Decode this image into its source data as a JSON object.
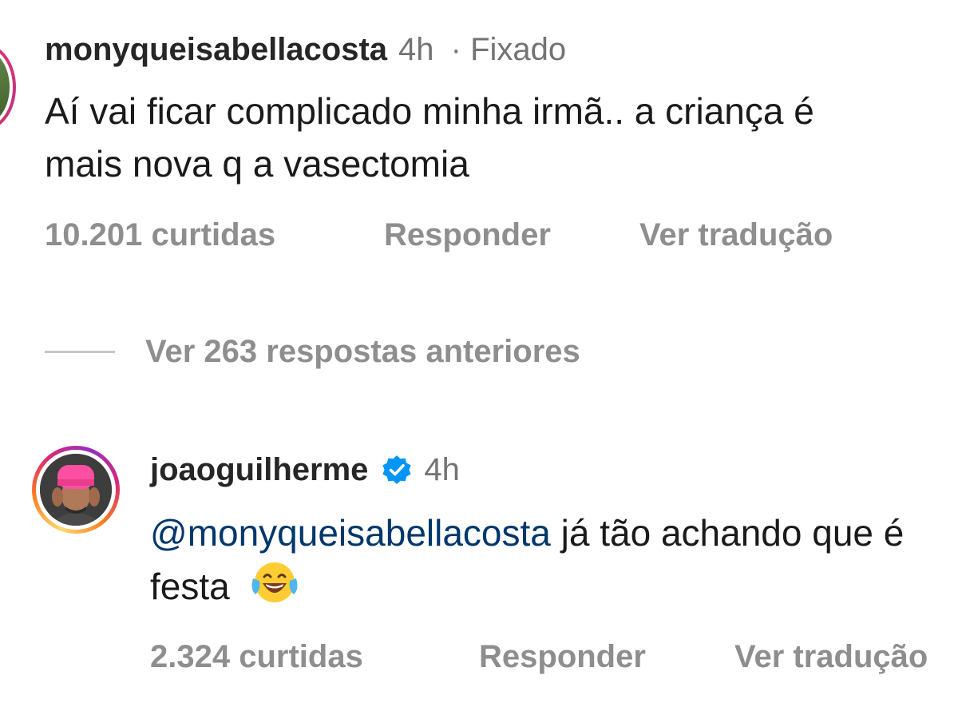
{
  "comment": {
    "username": "monyqueisabellacosta",
    "time": "4h",
    "pinned_label": "· Fixado",
    "text": "Aí vai ficar complicado minha irmã.. a criança é mais nova q a vasectomia",
    "likes_label": "10.201 curtidas",
    "reply_label": "Responder",
    "translate_label": "Ver tradução"
  },
  "view_more": {
    "label": "Ver 263 respostas anteriores"
  },
  "reply": {
    "username": "joaoguilherme",
    "verified": true,
    "time": "4h",
    "mention": "@monyqueisabellacosta",
    "text": " já tão achando que é festa",
    "emoji": "face-with-tears-of-joy",
    "likes_label": "2.324 curtidas",
    "reply_label": "Responder",
    "translate_label": "Ver tradução"
  },
  "colors": {
    "username": "#262626",
    "secondary_text": "#8e8e8e",
    "mention": "#00376b",
    "verified_badge": "#0095f6"
  }
}
